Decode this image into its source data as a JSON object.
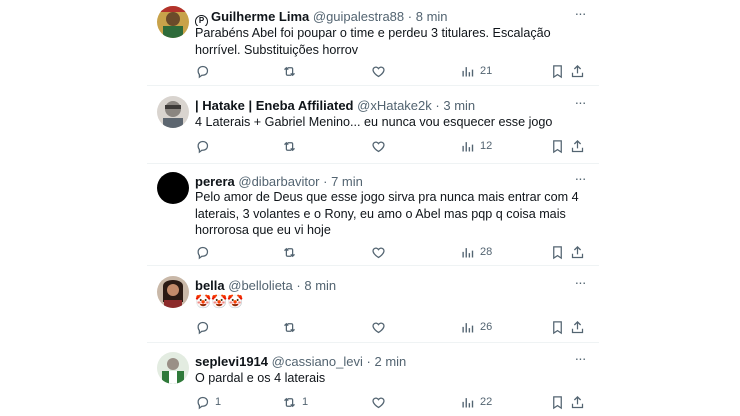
{
  "tweets": [
    {
      "name": "Guilherme Lima",
      "handle": "@guipalestra88",
      "time": "8 min",
      "text": "Parabéns Abel foi poupar o time e perdeu 3 titulares. Escalação horrível. Substituições horrov",
      "replies": "",
      "retweets": "",
      "views": "21"
    },
    {
      "name": "| Hatake | Eneba Affiliated",
      "handle": "@xHatake2k",
      "time": "3 min",
      "text": "4 Laterais + Gabriel Menino... eu nunca vou esquecer esse jogo",
      "replies": "",
      "retweets": "",
      "views": "12"
    },
    {
      "name": "perera",
      "handle": "@dibarbavitor",
      "time": "7 min",
      "text": "Pelo amor de Deus que esse jogo sirva pra nunca mais entrar com 4 laterais, 3 volantes e o Rony, eu amo o Abel mas pqp q coisa mais horrorosa que eu vi hoje",
      "replies": "",
      "retweets": "",
      "views": "28"
    },
    {
      "name": "bella",
      "handle": "@bellolieta",
      "time": "8 min",
      "text": "🤡🤡🤡",
      "replies": "",
      "retweets": "",
      "views": "26"
    },
    {
      "name": "seplevi1914",
      "handle": "@cassiano_levi",
      "time": "2 min",
      "text": "O pardal e os 4 laterais",
      "replies": "1",
      "retweets": "1",
      "views": "22"
    }
  ],
  "separator": "·",
  "more_glyph": "···",
  "badge_glyph": "P",
  "icons": [
    "reply-icon",
    "retweet-icon",
    "like-icon",
    "views-icon",
    "bookmark-icon",
    "share-icon",
    "more-icon"
  ],
  "colors": {
    "text": "#0f1419",
    "secondary": "#536471",
    "divider": "#eff3f4"
  }
}
